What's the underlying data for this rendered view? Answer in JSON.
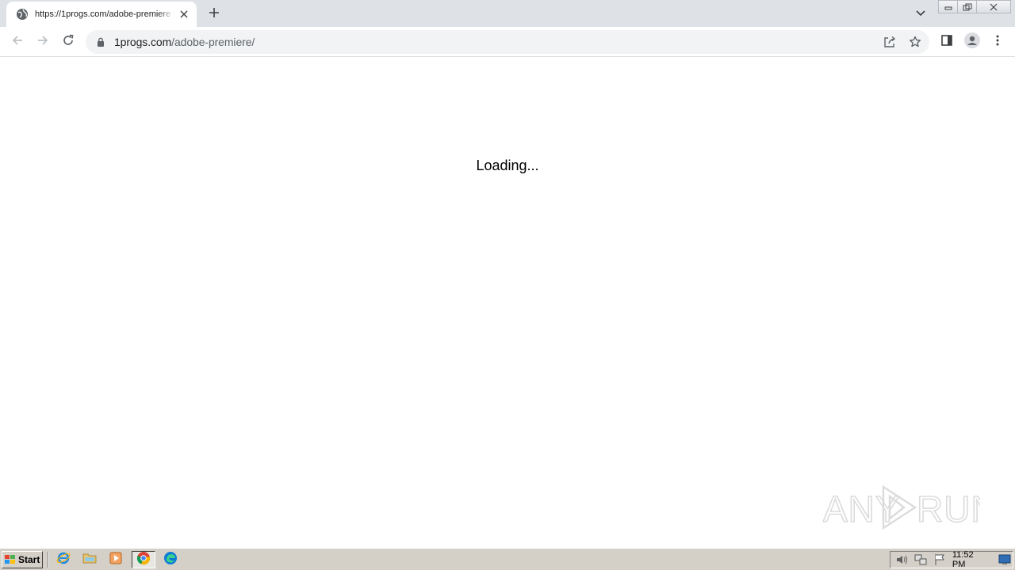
{
  "browser": {
    "tab": {
      "title": "https://1progs.com/adobe-premiere"
    },
    "omnibox": {
      "domain": "1progs.com",
      "path": "/adobe-premiere/"
    }
  },
  "page": {
    "loading_text": "Loading..."
  },
  "watermark": {
    "text": "ANY RUN"
  },
  "taskbar": {
    "start_label": "Start",
    "clock": "11:52 PM"
  },
  "colors": {
    "tabstrip": "#dee1e6",
    "omnibox": "#f1f3f4",
    "taskbar": "#d4d0c8"
  },
  "icons": [
    "globe-icon",
    "close-icon",
    "plus-icon",
    "chevron-down-icon",
    "back-arrow-icon",
    "forward-arrow-icon",
    "reload-icon",
    "lock-icon",
    "share-icon",
    "star-icon",
    "side-panel-icon",
    "profile-icon",
    "kebab-menu-icon",
    "ie-icon",
    "folder-icon",
    "media-player-icon",
    "chrome-icon",
    "edge-icon",
    "speaker-icon",
    "network-icon",
    "flag-icon",
    "desktop-icon"
  ]
}
